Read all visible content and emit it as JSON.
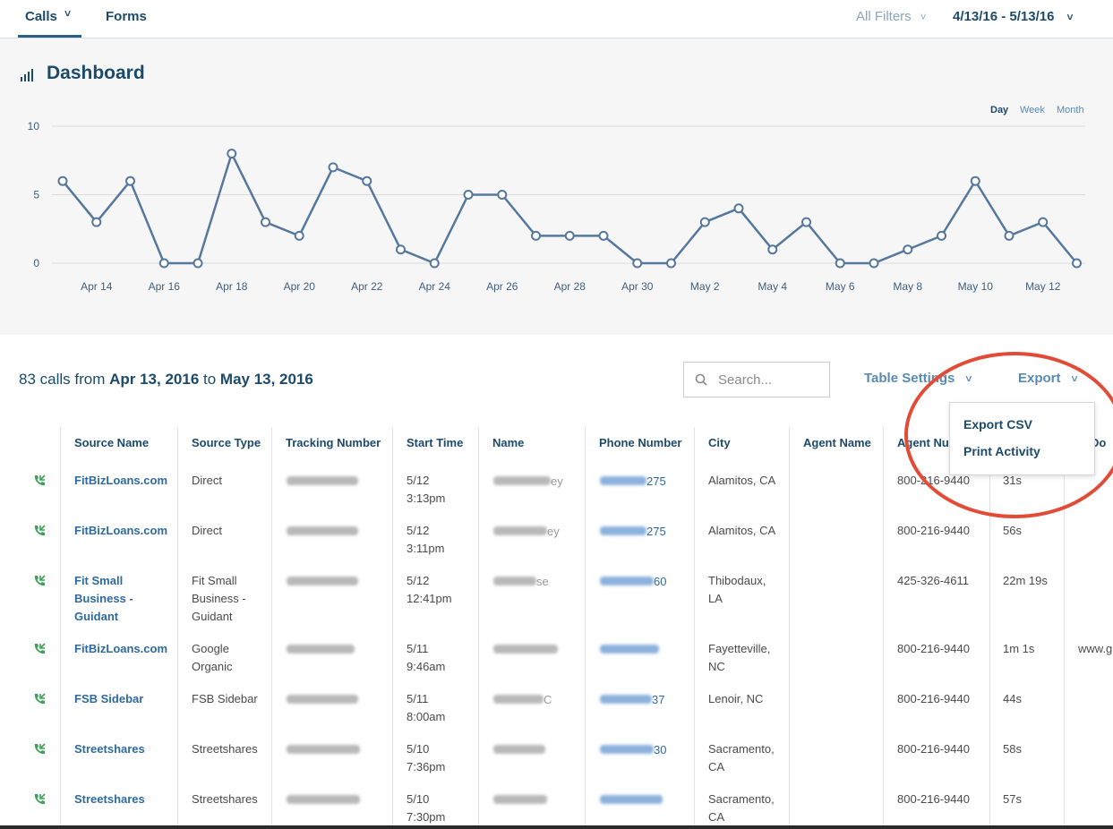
{
  "nav": {
    "tabs": [
      {
        "label": "Calls"
      },
      {
        "label": "Forms"
      }
    ],
    "filters_label": "All Filters",
    "date_range": "4/13/16 - 5/13/16"
  },
  "dashboard": {
    "title": "Dashboard",
    "range_options": [
      "Day",
      "Week",
      "Month"
    ],
    "selected_range": "Day"
  },
  "chart_data": {
    "type": "line",
    "title": "",
    "xlabel": "",
    "ylabel": "",
    "ylim": [
      0,
      10
    ],
    "yticks": [
      0,
      5,
      10
    ],
    "x_tick_labels": [
      "Apr 14",
      "Apr 16",
      "Apr 18",
      "Apr 20",
      "Apr 22",
      "Apr 24",
      "Apr 26",
      "Apr 28",
      "Apr 30",
      "May 2",
      "May 4",
      "May 6",
      "May 8",
      "May 10",
      "May 12"
    ],
    "x": [
      "Apr 13",
      "Apr 14",
      "Apr 15",
      "Apr 16",
      "Apr 17",
      "Apr 18",
      "Apr 19",
      "Apr 20",
      "Apr 21",
      "Apr 22",
      "Apr 23",
      "Apr 24",
      "Apr 25",
      "Apr 26",
      "Apr 27",
      "Apr 28",
      "Apr 29",
      "Apr 30",
      "May 1",
      "May 2",
      "May 3",
      "May 4",
      "May 5",
      "May 6",
      "May 7",
      "May 8",
      "May 9",
      "May 10",
      "May 11",
      "May 12",
      "May 13"
    ],
    "series": [
      {
        "values": [
          6,
          3,
          6,
          0,
          0,
          8,
          3,
          2,
          7,
          6,
          1,
          0,
          5,
          5,
          2,
          2,
          2,
          0,
          0,
          3,
          4,
          1,
          3,
          0,
          0,
          1,
          2,
          6,
          2,
          3,
          0
        ]
      }
    ],
    "grid": true,
    "color": "#56789c"
  },
  "summary": {
    "prefix": "83 calls from ",
    "start": "Apr 13, 2016",
    "middle": " to ",
    "end": "May 13, 2016"
  },
  "search": {
    "placeholder": "Search..."
  },
  "controls": {
    "table_settings": "Table Settings",
    "export": "Export"
  },
  "export_menu": {
    "items": [
      "Export CSV",
      "Print Activity"
    ]
  },
  "table": {
    "headers": [
      "Source Name",
      "Source Type",
      "Tracking Number",
      "Start Time",
      "Name",
      "Phone Number",
      "City",
      "Agent Name",
      "Agent Number",
      "",
      "f Do"
    ],
    "rows": [
      {
        "source": [
          "FitBizLoans.com"
        ],
        "type": [
          "Direct"
        ],
        "start": [
          "5/12",
          "3:13pm"
        ],
        "name_tail": "ey",
        "phone_tail": "275",
        "city": [
          "Alamitos, CA"
        ],
        "agent_number": "800-216-9440",
        "duration": "31s",
        "extra": ""
      },
      {
        "source": [
          "FitBizLoans.com"
        ],
        "type": [
          "Direct"
        ],
        "start": [
          "5/12",
          "3:11pm"
        ],
        "name_tail": "ey",
        "phone_tail": "275",
        "city": [
          "Alamitos, CA"
        ],
        "agent_number": "800-216-9440",
        "duration": "56s",
        "extra": ""
      },
      {
        "source": [
          "Fit Small",
          "Business -",
          "Guidant"
        ],
        "type": [
          "Fit Small",
          "Business -",
          "Guidant"
        ],
        "start": [
          "5/12",
          "12:41pm"
        ],
        "name_tail": "se",
        "phone_tail": "60",
        "city": [
          "Thibodaux,",
          "LA"
        ],
        "agent_number": "425-326-4611",
        "duration": "22m 19s",
        "extra": ""
      },
      {
        "source": [
          "FitBizLoans.com"
        ],
        "type": [
          "Google",
          "Organic"
        ],
        "start": [
          "5/11",
          "9:46am"
        ],
        "name_tail": "",
        "phone_tail": "",
        "city": [
          "Fayetteville,",
          "NC"
        ],
        "agent_number": "800-216-9440",
        "duration": "1m 1s",
        "extra": "www.g"
      },
      {
        "source": [
          "FSB Sidebar"
        ],
        "type": [
          "FSB Sidebar"
        ],
        "start": [
          "5/11",
          "8:00am"
        ],
        "name_tail": "C",
        "phone_tail": "37",
        "city": [
          "Lenoir, NC"
        ],
        "agent_number": "800-216-9440",
        "duration": "44s",
        "extra": ""
      },
      {
        "source": [
          "Streetshares"
        ],
        "type": [
          "Streetshares"
        ],
        "start": [
          "5/10",
          "7:36pm"
        ],
        "name_tail": "",
        "phone_tail": "30",
        "city": [
          "Sacramento,",
          "CA"
        ],
        "agent_number": "800-216-9440",
        "duration": "58s",
        "extra": ""
      },
      {
        "source": [
          "Streetshares"
        ],
        "type": [
          "Streetshares"
        ],
        "start": [
          "5/10",
          "7:30pm"
        ],
        "name_tail": "",
        "phone_tail": "",
        "city": [
          "Sacramento,",
          "CA"
        ],
        "agent_number": "800-216-9440",
        "duration": "57s",
        "extra": ""
      }
    ]
  }
}
